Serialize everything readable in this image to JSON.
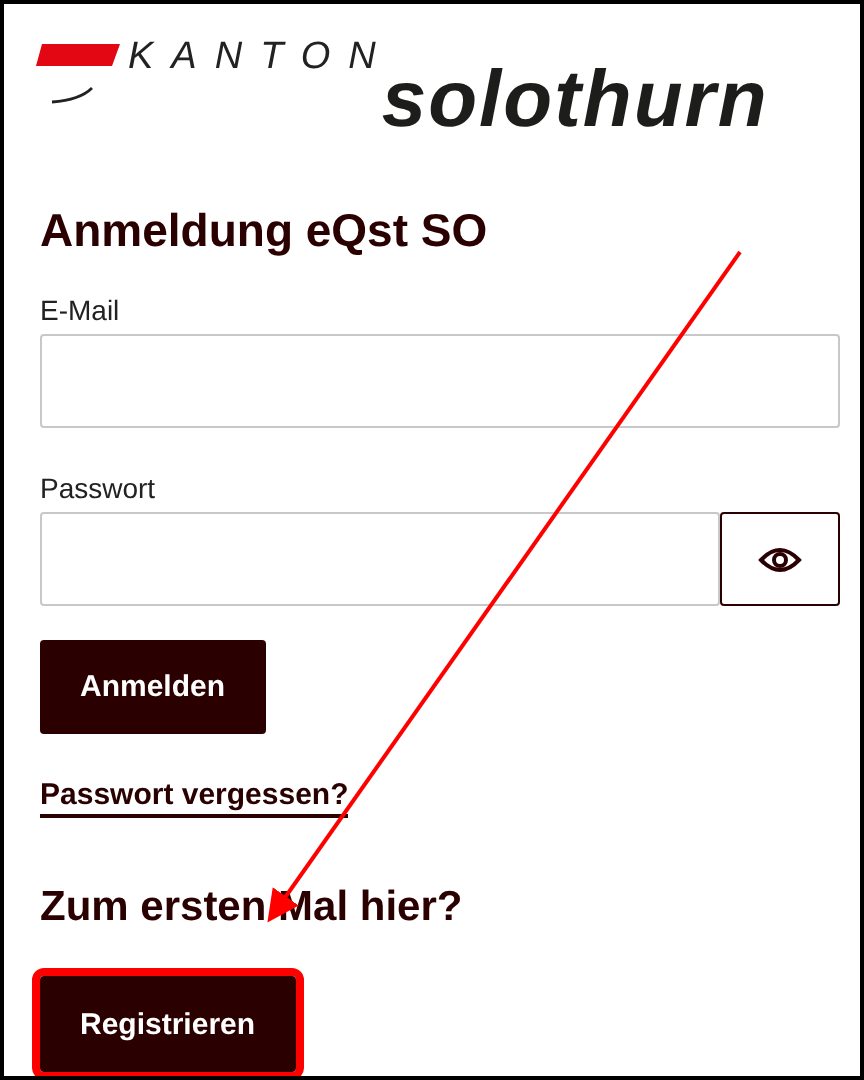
{
  "logo": {
    "prefix": "KANTON",
    "name": "solothurn"
  },
  "login": {
    "title": "Anmeldung eQst SO",
    "fields": [
      {
        "label": "E-Mail",
        "kind": "text"
      },
      {
        "label": "Passwort",
        "kind": "password"
      }
    ],
    "submit": "Anmelden",
    "forgot_link": "Passwort vergessen?"
  },
  "register": {
    "title": "Zum ersten Mal hier?",
    "button": "Registrieren",
    "highlighted": true
  }
}
